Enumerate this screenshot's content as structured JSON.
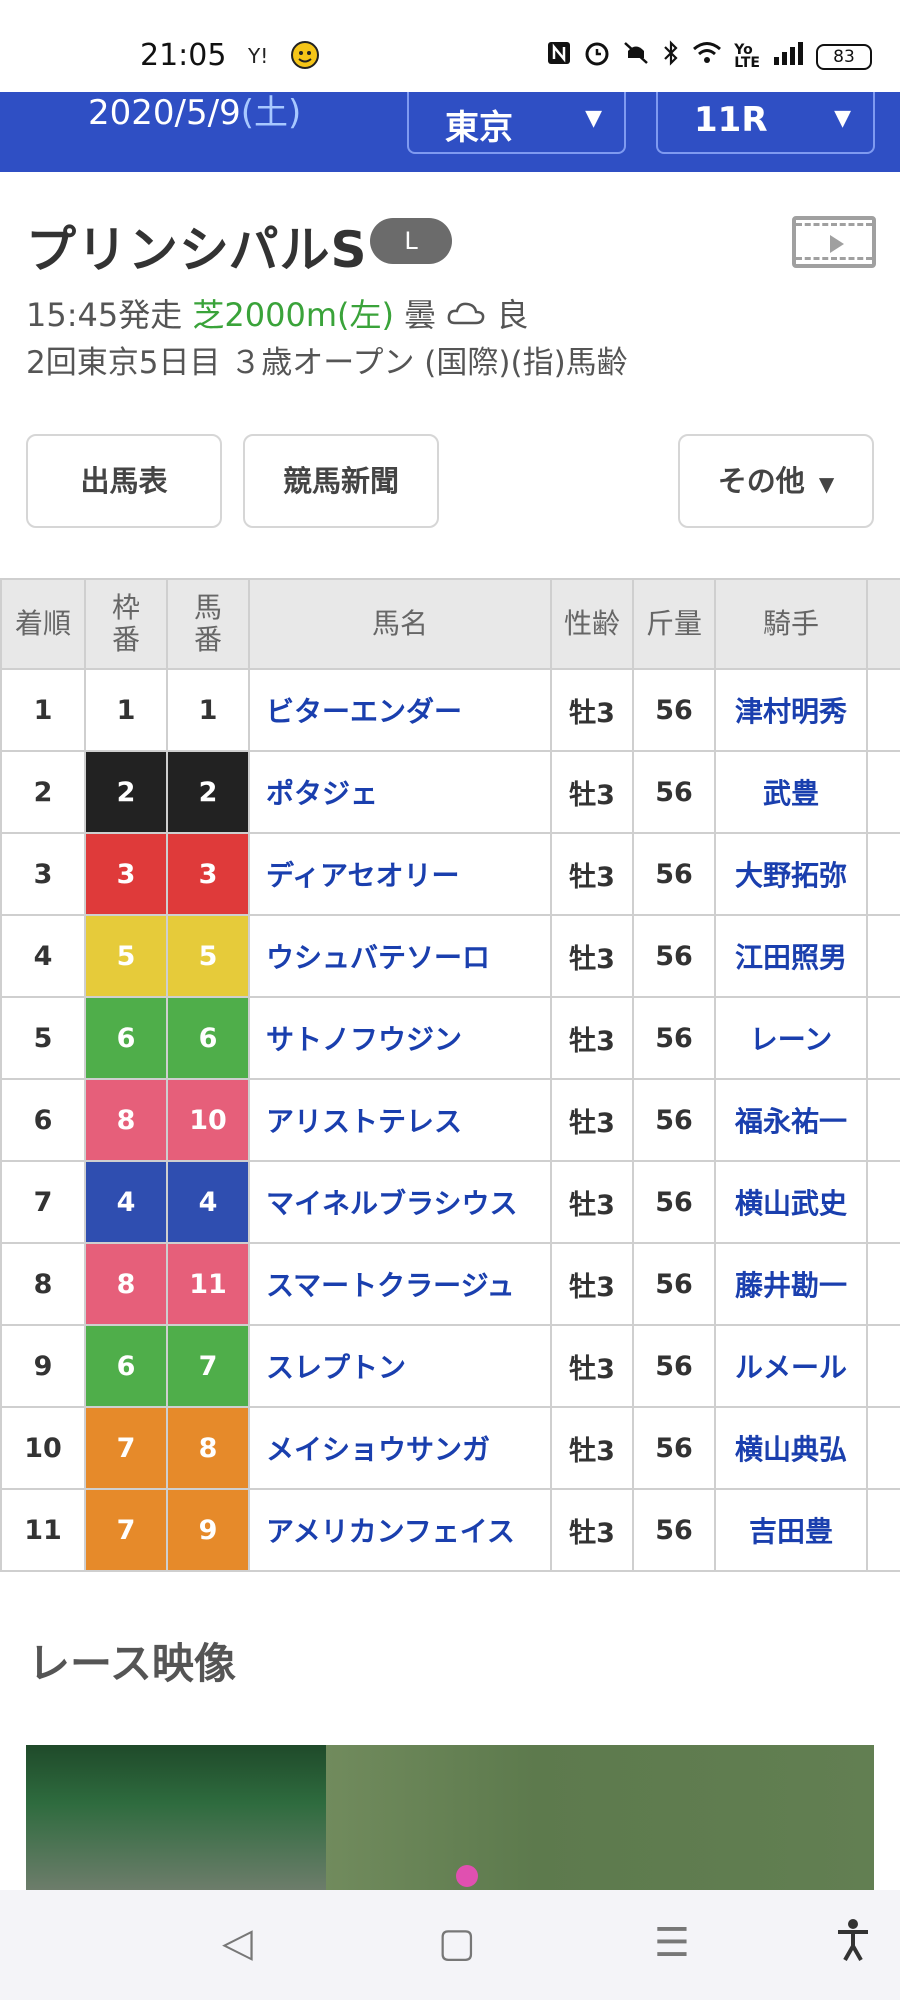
{
  "status_bar": {
    "time": "21:05",
    "app_icon_1": "Y!",
    "app_icon_2": "face-icon",
    "battery": "83"
  },
  "header": {
    "date": "2020/5/9",
    "day_of_week": "(土)",
    "venue": "東京",
    "race_no": "11R"
  },
  "race": {
    "name": "プリンシパルS",
    "grade": "L",
    "time": "15:45発走",
    "course": "芝2000m(左)",
    "weather": "曇",
    "going": "良",
    "sub": "2回東京5日目 ３歳オープン (国際)(指)馬齢"
  },
  "buttons": {
    "card": "出馬表",
    "newspaper": "競馬新聞",
    "other": "その他"
  },
  "table": {
    "headers": [
      "着順",
      "枠番",
      "馬番",
      "馬名",
      "性齢",
      "斤量",
      "騎手"
    ],
    "rows": [
      {
        "rank": "1",
        "waku": "1",
        "umaban": "1",
        "horse": "ビターエンダー",
        "sex_age": "牡3",
        "weight": "56",
        "jockey": "津村明秀",
        "frame_color": "#ffffff",
        "text_color": "#333333"
      },
      {
        "rank": "2",
        "waku": "2",
        "umaban": "2",
        "horse": "ポタジェ",
        "sex_age": "牡3",
        "weight": "56",
        "jockey": "武豊",
        "frame_color": "#222222",
        "text_color": "#ffffff"
      },
      {
        "rank": "3",
        "waku": "3",
        "umaban": "3",
        "horse": "ディアセオリー",
        "sex_age": "牡3",
        "weight": "56",
        "jockey": "大野拓弥",
        "frame_color": "#df3a3a",
        "text_color": "#ffffff"
      },
      {
        "rank": "4",
        "waku": "5",
        "umaban": "5",
        "horse": "ウシュバテソーロ",
        "sex_age": "牡3",
        "weight": "56",
        "jockey": "江田照男",
        "frame_color": "#e6cb3a",
        "text_color": "#ffffff"
      },
      {
        "rank": "5",
        "waku": "6",
        "umaban": "6",
        "horse": "サトノフウジン",
        "sex_age": "牡3",
        "weight": "56",
        "jockey": "レーン",
        "frame_color": "#4fae4a",
        "text_color": "#ffffff"
      },
      {
        "rank": "6",
        "waku": "8",
        "umaban": "10",
        "horse": "アリストテレス",
        "sex_age": "牡3",
        "weight": "56",
        "jockey": "福永祐一",
        "frame_color": "#e65f7a",
        "text_color": "#ffffff"
      },
      {
        "rank": "7",
        "waku": "4",
        "umaban": "4",
        "horse": "マイネルブラシウス",
        "sex_age": "牡3",
        "weight": "56",
        "jockey": "横山武史",
        "frame_color": "#2f4eb0",
        "text_color": "#ffffff"
      },
      {
        "rank": "8",
        "waku": "8",
        "umaban": "11",
        "horse": "スマートクラージュ",
        "sex_age": "牡3",
        "weight": "56",
        "jockey": "藤井勘一",
        "frame_color": "#e65f7a",
        "text_color": "#ffffff"
      },
      {
        "rank": "9",
        "waku": "6",
        "umaban": "7",
        "horse": "スレプトン",
        "sex_age": "牡3",
        "weight": "56",
        "jockey": "ルメール",
        "frame_color": "#4fae4a",
        "text_color": "#ffffff"
      },
      {
        "rank": "10",
        "waku": "7",
        "umaban": "8",
        "horse": "メイショウサンガ",
        "sex_age": "牡3",
        "weight": "56",
        "jockey": "横山典弘",
        "frame_color": "#e68a2a",
        "text_color": "#ffffff"
      },
      {
        "rank": "11",
        "waku": "7",
        "umaban": "9",
        "horse": "アメリカンフェイス",
        "sex_age": "牡3",
        "weight": "56",
        "jockey": "吉田豊",
        "frame_color": "#e68a2a",
        "text_color": "#ffffff"
      }
    ]
  },
  "video_section": {
    "title": "レース映像"
  },
  "nav": {
    "back": "◁",
    "home": "▢",
    "menu": "☰",
    "accessibility": "accessibility-icon"
  }
}
